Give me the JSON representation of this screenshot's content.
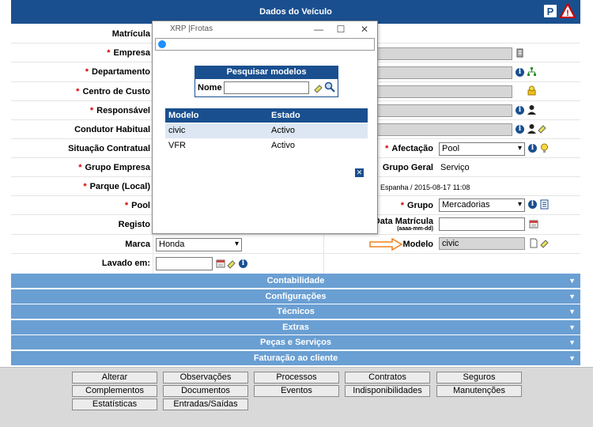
{
  "header": {
    "title": "Dados do Veículo"
  },
  "labels": {
    "matricula": "Matrícula",
    "empresa": "Empresa",
    "departamento": "Departamento",
    "centro_custo": "Centro de Custo",
    "responsavel": "Responsável",
    "condutor": "Condutor Habitual",
    "situacao": "Situação Contratual",
    "grupo_empresa": "Grupo Empresa",
    "parque": "Parque (Local)",
    "pool": "Pool",
    "registo": "Registo",
    "marca": "Marca",
    "lavado": "Lavado em:",
    "afectacao": "Afectação",
    "grupo_geral": "Grupo Geral",
    "grupo": "Grupo",
    "data_matricula": "Data Matrícula",
    "data_matricula_fmt": "(aaaa-mm-dd)",
    "modelo": "Modelo"
  },
  "values": {
    "marca": "Honda",
    "afectacao": "Pool",
    "grupo_geral": "Serviço",
    "parque_info": ", Espanha / 2015-08-17 11:08",
    "grupo": "Mercadorias",
    "modelo": "civic"
  },
  "sections": [
    "Contabilidade",
    "Configurações",
    "Técnicos",
    "Extras",
    "Peças e Serviços",
    "Faturação ao cliente"
  ],
  "buttons": [
    [
      "Alterar",
      "Observações",
      "Processos",
      "Contratos",
      "Seguros"
    ],
    [
      "Complementos",
      "Documentos",
      "Eventos",
      "Indisponibilidades",
      "Manutenções"
    ],
    [
      "Estatísticas",
      "Entradas/Saídas"
    ]
  ],
  "modal": {
    "window_title": "XRP |Frotas",
    "search_title": "Pesquisar modelos",
    "name_label": "Nome",
    "name_value": "",
    "columns": [
      "Modelo",
      "Estado"
    ],
    "rows": [
      {
        "modelo": "civic",
        "estado": "Activo"
      },
      {
        "modelo": "VFR",
        "estado": "Activo"
      }
    ]
  },
  "colors": {
    "header": "#1a4f8f",
    "section_bar": "#6a9fd3",
    "arrow": "#f0801a"
  }
}
